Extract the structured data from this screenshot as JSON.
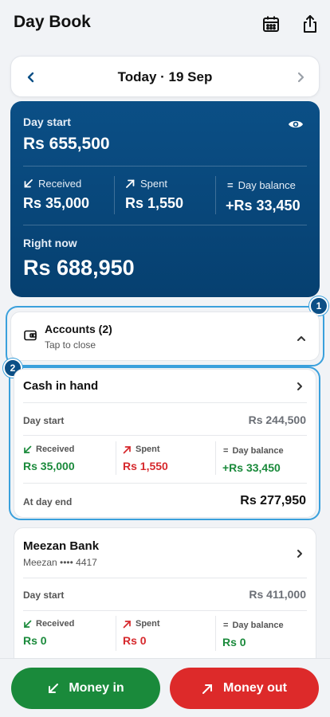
{
  "header": {
    "title": "Day Book",
    "calendar_icon": "calendar-icon",
    "share_icon": "share-icon"
  },
  "date_nav": {
    "label": "Today · 19 Sep"
  },
  "summary": {
    "day_start_label": "Day start",
    "day_start_value": "Rs 655,500",
    "received_label": "Received",
    "received_value": "Rs 35,000",
    "spent_label": "Spent",
    "spent_value": "Rs 1,550",
    "balance_label": "Day balance",
    "balance_value": "+Rs 33,450",
    "right_now_label": "Right now",
    "right_now_value": "Rs 688,950",
    "colors": {
      "background": "#0b4f86"
    }
  },
  "accounts": {
    "title": "Accounts (2)",
    "subtitle": "Tap to close",
    "badges": [
      "1",
      "2"
    ]
  },
  "account_cards": [
    {
      "name": "Cash in hand",
      "day_start_label": "Day start",
      "day_start_value": "Rs 244,500",
      "received_label": "Received",
      "received_value": "Rs 35,000",
      "spent_label": "Spent",
      "spent_value": "Rs 1,550",
      "balance_label": "Day balance",
      "balance_value": "+Rs 33,450",
      "end_label": "At day end",
      "end_value": "Rs 277,950"
    },
    {
      "name": "Meezan Bank",
      "sub": "Meezan •••• 4417",
      "day_start_label": "Day start",
      "day_start_value": "Rs 411,000",
      "received_label": "Received",
      "received_value": "Rs 0",
      "spent_label": "Spent",
      "spent_value": "Rs 0",
      "balance_label": "Day balance",
      "balance_value": "Rs 0"
    }
  ],
  "actions": {
    "money_in": "Money in",
    "money_out": "Money out",
    "colors": {
      "in": "#1a8a3b",
      "out": "#dd2a2a"
    }
  }
}
